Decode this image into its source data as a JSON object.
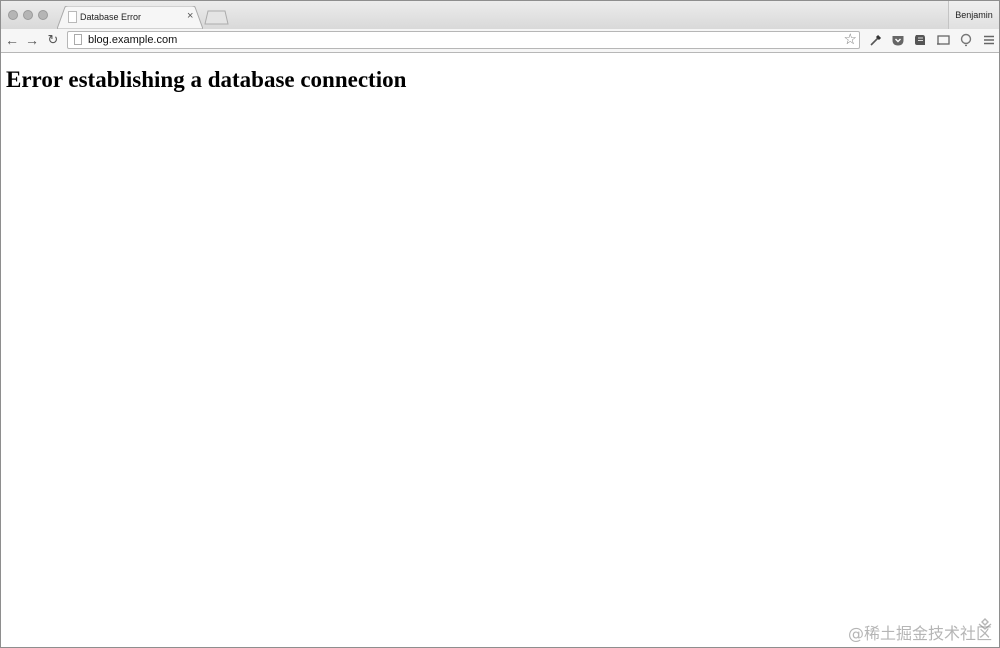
{
  "browser": {
    "tab": {
      "title": "Database Error",
      "close_glyph": "×"
    },
    "profile_name": "Benjamin",
    "address_bar": {
      "url": "blog.example.com"
    },
    "nav": {
      "back_glyph": "←",
      "forward_glyph": "→",
      "reload_glyph": "↻"
    },
    "bookmark_glyph": "☆",
    "extensions": [
      "eyedropper-icon",
      "pocket-icon",
      "evernote-icon",
      "cast-icon",
      "lightbulb-icon",
      "menu-icon"
    ]
  },
  "page": {
    "heading": "Error establishing a database connection"
  },
  "watermark": {
    "text": "@稀土掘金技术社区"
  }
}
